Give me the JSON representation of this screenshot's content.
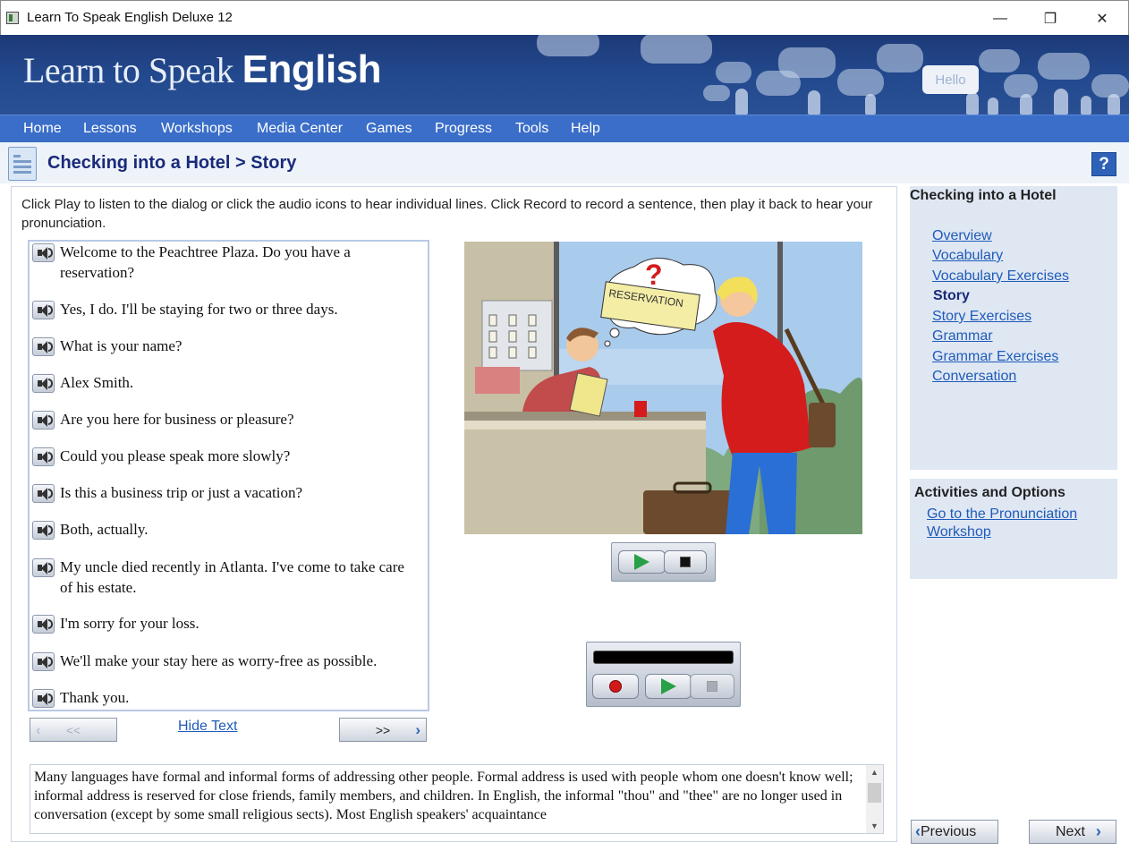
{
  "window": {
    "title": "Learn To Speak English Deluxe 12",
    "minimize_glyph": "—",
    "maximize_glyph": "❐",
    "close_glyph": "✕"
  },
  "banner": {
    "logo_light": "Learn to Speak",
    "logo_bold": "English",
    "hello_bubble": "Hello"
  },
  "menu": [
    "Home",
    "Lessons",
    "Workshops",
    "Media Center",
    "Games",
    "Progress",
    "Tools",
    "Help"
  ],
  "page": {
    "title": "Checking into a Hotel > Story",
    "help_label": "?"
  },
  "instructions": "Click Play to listen to the dialog or click the audio icons to hear individual lines. Click Record to record a sentence, then play it back to hear your pronunciation.",
  "dialog_lines": [
    "Welcome to the Peachtree Plaza.  Do you have a reservation?",
    "Yes, I do.  I'll be staying for two or three days.",
    "What is your name?",
    "Alex Smith.",
    "Are you here for business or pleasure?",
    "Could you please speak more slowly?",
    "Is this a business trip or just a vacation?",
    "Both, actually.",
    "My uncle died recently in Atlanta.  I've come to take care of his estate.",
    "I'm sorry for your loss.",
    "We'll make your stay here as worry-free as possible.",
    "Thank you."
  ],
  "dialog_nav": {
    "prev_label": "<<",
    "next_label": ">>",
    "hide_text": "Hide Text"
  },
  "scene": {
    "sign_text": "RESERVATION",
    "thought_symbol": "?"
  },
  "notes_text": "Many languages have formal and informal forms of addressing other people. Formal address is used with people whom one doesn't know well; informal address is reserved for close friends, family members, and children. In English, the informal \"thou\" and \"thee\" are no longer used in conversation (except by some small religious sects).  Most English speakers' acquaintance",
  "sidebar": {
    "lesson_title": "Checking into a Hotel",
    "links": [
      "Overview",
      "Vocabulary",
      "Vocabulary Exercises",
      "Story",
      "Story Exercises",
      "Grammar",
      "Grammar Exercises",
      "Conversation"
    ],
    "current": "Story",
    "activities_title": "Activities and Options",
    "activity_link": "Go to the Pronunciation Workshop"
  },
  "footer": {
    "previous": "Previous",
    "next": "Next"
  },
  "colors": {
    "menubar": "#3a6ec8",
    "banner": "#234a8f",
    "title_text": "#1a2a7a",
    "link": "#1f5bb8",
    "sidebar_bg": "#dfe7f3"
  }
}
